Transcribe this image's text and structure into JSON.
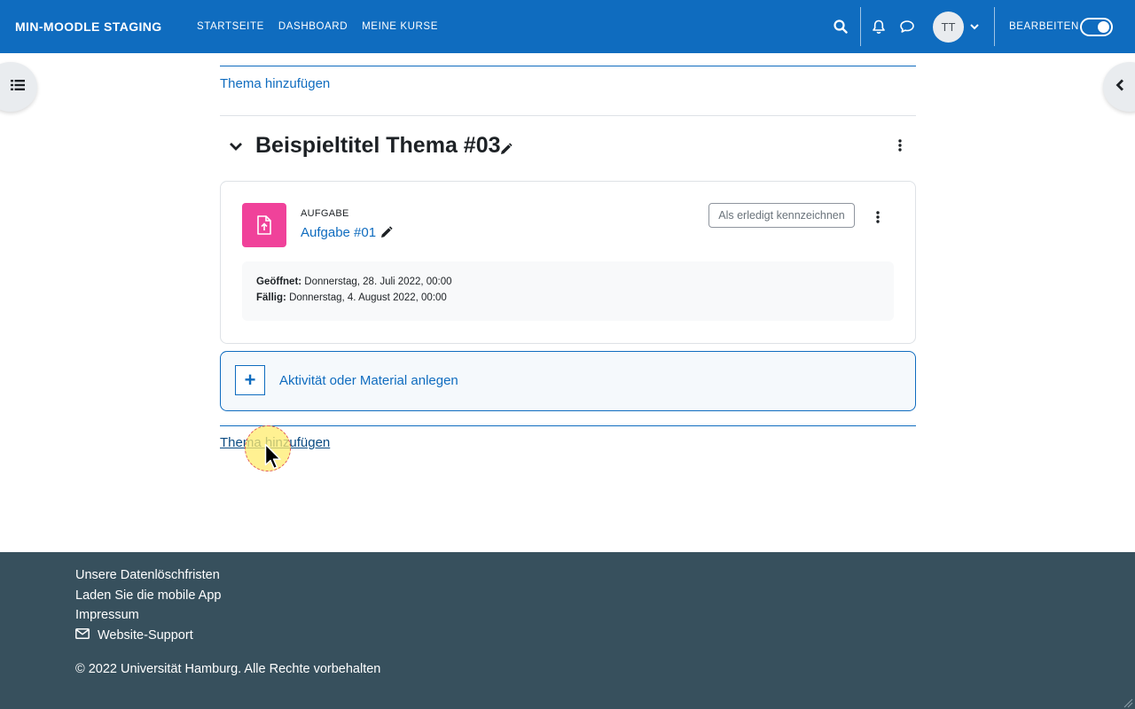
{
  "navbar": {
    "brand": "MIN-MOODLE STAGING",
    "links": [
      "STARTSEITE",
      "DASHBOARD",
      "MEINE KURSE"
    ],
    "avatar_initials": "TT",
    "edit_label": "BEARBEITEN",
    "edit_mode_on": true,
    "accent_color": "#0f6cbf"
  },
  "main": {
    "add_topic_top": "Thema hinzufügen",
    "section": {
      "title": "Beispieltitel Thema #03",
      "activity": {
        "type": "AUFGABE",
        "name": "Aufgabe #01",
        "done_button": "Als erledigt kennzeichnen",
        "opened_label": "Geöffnet:",
        "opened_value": " Donnerstag, 28. Juli 2022, 00:00",
        "due_label": "Fällig:",
        "due_value": " Donnerstag, 4. August 2022, 00:00",
        "icon": "assignment-upload-icon",
        "icon_color": "#f0429a"
      },
      "add_activity": "Aktivität oder Material anlegen"
    },
    "add_topic_bottom": "Thema hinzufügen"
  },
  "footer": {
    "links": [
      "Unsere Datenlöschfristen",
      "Laden Sie die mobile App",
      "Impressum"
    ],
    "support": "Website-Support",
    "copyright": "© 2022 Universität Hamburg. Alle Rechte vorbehalten",
    "bg_color": "#37505d"
  }
}
